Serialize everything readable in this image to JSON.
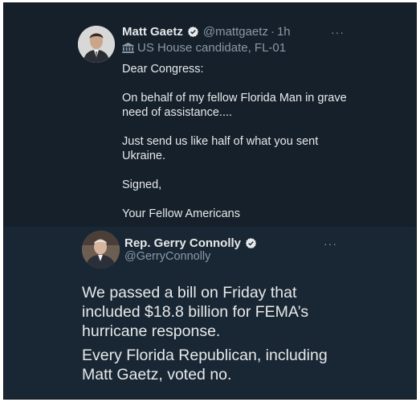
{
  "tweet1": {
    "name": "Matt Gaetz",
    "handle": "@mattgaetz",
    "separator": "·",
    "time": "1h",
    "affiliation": "US House candidate, FL-01",
    "more_label": "···",
    "paragraphs": [
      "Dear Congress:",
      "On behalf of my fellow Florida Man in grave need of assistance....",
      "Just send us like half of what you sent Ukraine.",
      "Signed,",
      "Your Fellow Americans"
    ]
  },
  "tweet2": {
    "name": "Rep. Gerry Connolly",
    "handle": "@GerryConnolly",
    "more_label": "···",
    "paragraphs": [
      "We passed a bill on Friday that included $18.8 billion for FEMA’s hurricane response.",
      "Every Florida Republican, including Matt Gaetz, voted no."
    ]
  },
  "colors": {
    "background": "#15202b",
    "quoted_background": "#192734",
    "text": "#e7e9ea",
    "secondary": "#8b98a5",
    "verified_badge": "#e7e9ea"
  },
  "icons": {
    "verified": "verified-badge-icon",
    "affiliation": "government-building-icon",
    "more": "more-horizontal-icon"
  }
}
